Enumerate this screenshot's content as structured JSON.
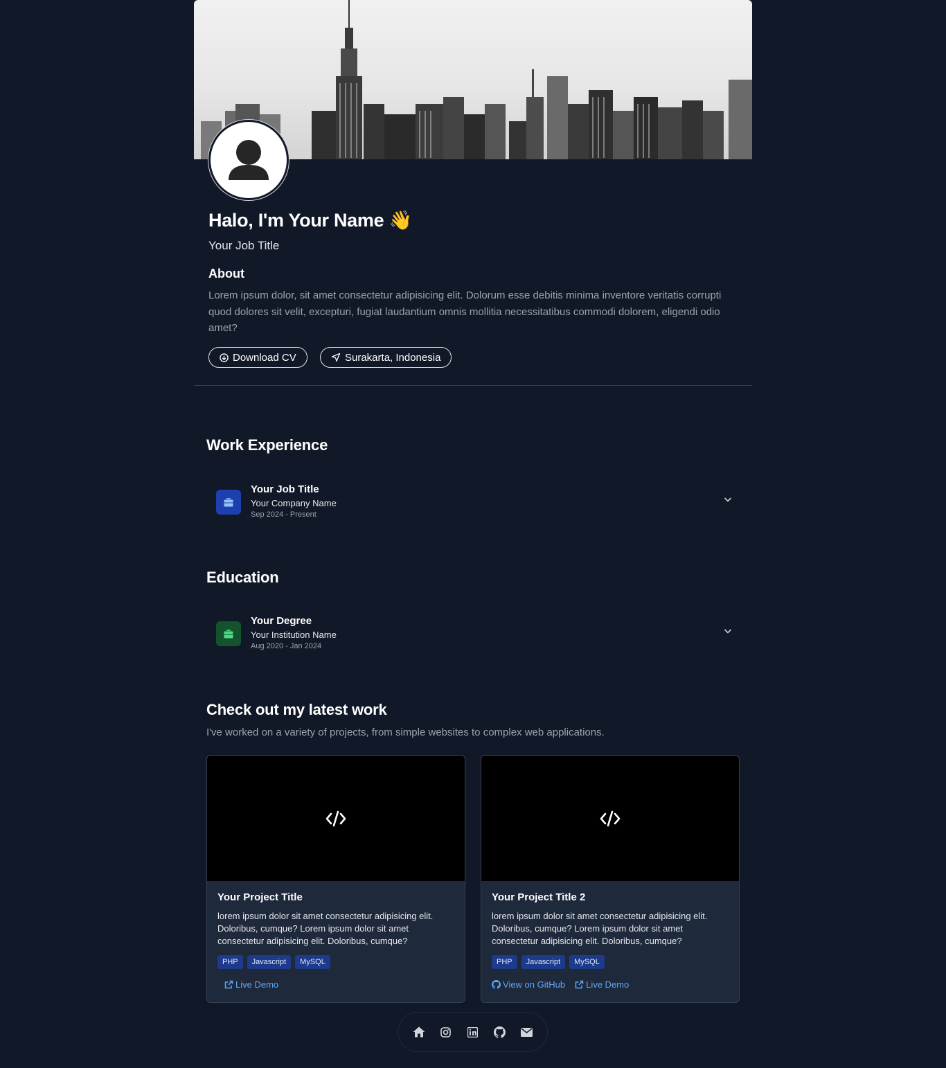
{
  "profile": {
    "name": "Halo, I'm Your Name 👋",
    "job_title": "Your Job Title",
    "about_heading": "About",
    "about_text": "Lorem ipsum dolor, sit amet consectetur adipisicing elit. Dolorum esse debitis minima inventore veritatis corrupti quod dolores sit velit, excepturi, fugiat laudantium omnis mollitia necessitatibus commodi dolorem, eligendi odio amet?",
    "download_label": "Download CV",
    "location": "Surakarta, Indonesia"
  },
  "work": {
    "heading": "Work Experience",
    "items": [
      {
        "title": "Your Job Title",
        "org": "Your Company Name",
        "period": "Sep 2024 - Present",
        "icon": "briefcase-icon",
        "color": "#1e40af"
      }
    ]
  },
  "education": {
    "heading": "Education",
    "items": [
      {
        "title": "Your Degree",
        "org": "Your Institution Name",
        "period": "Aug 2020 - Jan 2024",
        "icon": "briefcase-icon",
        "color": "#14532d"
      }
    ]
  },
  "projects": {
    "heading": "Check out my latest work",
    "subtitle": "I've worked on a variety of projects, from simple websites to complex web applications.",
    "items": [
      {
        "title": "Your Project Title",
        "description": "lorem ipsum dolor sit amet consectetur adipisicing elit. Doloribus, cumque? Lorem ipsum dolor sit amet consectetur adipisicing elit. Doloribus, cumque?",
        "tags": [
          "PHP",
          "Javascript",
          "MySQL"
        ],
        "live_demo": "Live Demo"
      },
      {
        "title": "Your Project Title 2",
        "description": "lorem ipsum dolor sit amet consectetur adipisicing elit. Doloribus, cumque? Lorem ipsum dolor sit amet consectetur adipisicing elit. Doloribus, cumque?",
        "tags": [
          "PHP",
          "Javascript",
          "MySQL"
        ],
        "github": "View on GitHub",
        "live_demo": "Live Demo"
      }
    ]
  },
  "dock": [
    "home-icon",
    "instagram-icon",
    "linkedin-icon",
    "github-icon",
    "mail-icon"
  ],
  "colors": {
    "background": "#111827",
    "card": "#1e293b",
    "link": "#60a5fa",
    "tag": "#1e3a8a"
  }
}
